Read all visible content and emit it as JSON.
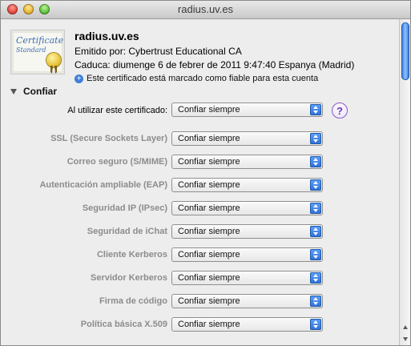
{
  "window": {
    "title": "radius.uv.es"
  },
  "certificate": {
    "icon_text": {
      "title": "Certificate",
      "subtitle": "Standard"
    },
    "name": "radius.uv.es",
    "issued_by": "Emitido por: Cybertrust Educational CA",
    "expires": "Caduca: diumenge 6 de febrer de 2011 9:47:40 Espanya (Madrid)",
    "trusted_note": "Este certificado está marcado como fiable para esta cuenta"
  },
  "trust": {
    "section_label": "Confiar",
    "when_using_label": "Al utilizar este certificado:",
    "when_using_value": "Confiar siempre",
    "help_label": "?",
    "rows": [
      {
        "label": "SSL (Secure Sockets Layer)",
        "value": "Confiar siempre"
      },
      {
        "label": "Correo seguro (S/MIME)",
        "value": "Confiar siempre"
      },
      {
        "label": "Autenticación ampliable (EAP)",
        "value": "Confiar siempre"
      },
      {
        "label": "Seguridad IP (IPsec)",
        "value": "Confiar siempre"
      },
      {
        "label": "Seguridad de iChat",
        "value": "Confiar siempre"
      },
      {
        "label": "Cliente Kerberos",
        "value": "Confiar siempre"
      },
      {
        "label": "Servidor Kerberos",
        "value": "Confiar siempre"
      },
      {
        "label": "Firma de código",
        "value": "Confiar siempre"
      },
      {
        "label": "Política básica X.509",
        "value": "Confiar siempre"
      }
    ]
  },
  "icons": {
    "close": "close-button",
    "minimize": "minimize-button",
    "zoom": "zoom-button",
    "disclosure": "disclosure-triangle-icon",
    "plus": "plus-circle-icon",
    "help": "question-mark-icon"
  },
  "colors": {
    "accent": "#2d6fd6",
    "help": "#6b34b8"
  }
}
